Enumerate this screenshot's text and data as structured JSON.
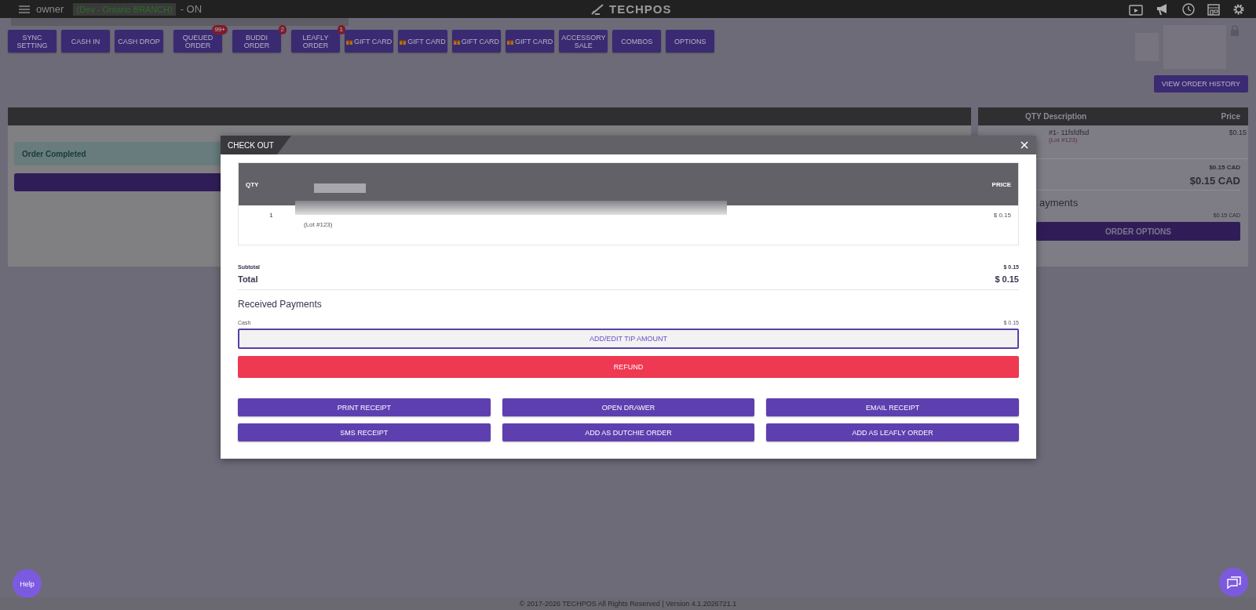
{
  "header": {
    "user": "owner",
    "branch": "(Dev - Ontario BRANCH)",
    "status": "- ON",
    "logo": "TECHPOS"
  },
  "toolbar": [
    {
      "kind": "plain",
      "label": "SYNC\nSETTING"
    },
    {
      "kind": "plain",
      "label": "CASH IN"
    },
    {
      "kind": "plain",
      "label": "CASH DROP"
    },
    {
      "kind": "plain",
      "label": "QUEUED\nORDER",
      "badge": "99+"
    },
    {
      "kind": "plain",
      "label": "BUDDI\nORDER",
      "badge": "2"
    },
    {
      "kind": "plain",
      "label": "LEAFLY\nORDER",
      "badge": "1"
    },
    {
      "kind": "gift",
      "label": "GIFT CARD"
    },
    {
      "kind": "gift",
      "label": "GIFT CARD"
    },
    {
      "kind": "gift",
      "label": "GIFT CARD"
    },
    {
      "kind": "gift",
      "label": "GIFT CARD"
    },
    {
      "kind": "plain",
      "label": "ACCESSORY\nSALE"
    },
    {
      "kind": "plain",
      "label": "COMBOS"
    },
    {
      "kind": "plain",
      "label": "OPTIONS"
    }
  ],
  "view_order_history": "VIEW ORDER HISTORY",
  "order_panel": {
    "alert": "Order Completed"
  },
  "cart": {
    "columns": [
      "QTY Description",
      "Price"
    ],
    "items": [
      {
        "name": "#1- 11fsfdfsd",
        "lot": "(Lot #123)",
        "price": "$0.15"
      }
    ],
    "subtotal": "$0.15 CAD",
    "total": "$0.15 CAD",
    "payments_heading": "ayments",
    "payment_amount": "$0.15 CAD",
    "order_options": "ORDER OPTIONS"
  },
  "checkout": {
    "title": "CHECK OUT",
    "columns": [
      "QTY",
      "PRICE"
    ],
    "rows": [
      {
        "qty": "1",
        "lot": "(Lot #123)",
        "price": "$ 0.15"
      }
    ],
    "subtotal_label": "Subtotal",
    "subtotal": "$ 0.15",
    "total_label": "Total",
    "total": "$ 0.15",
    "payments_heading": "Received Payments",
    "payments": [
      {
        "method": "Cash",
        "amount": "$ 0.15"
      }
    ],
    "tip_button": "ADD/EDIT TIP AMOUNT",
    "refund_button": "REFUND",
    "actions": [
      "PRINT RECEIPT",
      "OPEN DRAWER",
      "EMAIL RECEIPT",
      "SMS RECEIPT",
      "ADD AS DUTCHIE ORDER",
      "ADD AS LEAFLY ORDER"
    ]
  },
  "help": "Help",
  "footer": "© 2017-2026 TECHPOS All Rights Reserved | Version 4.1.2026721.1"
}
